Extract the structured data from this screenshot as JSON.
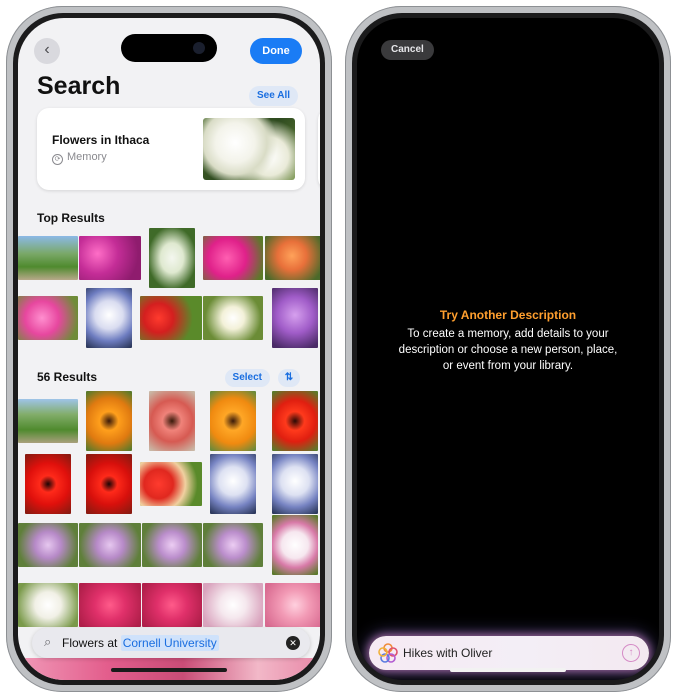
{
  "left_phone": {
    "back_icon": "chevron-left-icon",
    "done_label": "Done",
    "title": "Search",
    "see_all_label": "See All",
    "memory_card": {
      "title": "Flowers in Ithaca",
      "subtitle": "Memory",
      "icon": "memory-icon"
    },
    "top_results_label": "Top Results",
    "results_count_label": "56 Results",
    "select_label": "Select",
    "sort_icon": "sort-arrows-icon",
    "search": {
      "prefix": "Flowers at",
      "highlight": "Cornell University",
      "icon": "search-icon",
      "clear_icon": "clear-icon"
    },
    "photo_subjects": [
      "garden path",
      "pink azaleas",
      "white hyacinth",
      "pink flowers",
      "orange lilies",
      "pink blossoms",
      "purple-white iris",
      "red tulips",
      "white lilies",
      "purple bloom",
      "garden lawn",
      "orange tulip",
      "pink tulip",
      "orange tulip",
      "red tulip",
      "red tulip",
      "red tulip",
      "tulip bed",
      "white iris",
      "white iris",
      "purple bee balm",
      "purple bee balm",
      "purple bee balm",
      "purple bee balm",
      "white orchid",
      "white flowers",
      "pink flowers",
      "pink flowers",
      "white flowers",
      "pink flowers"
    ]
  },
  "right_phone": {
    "cancel_label": "Cancel",
    "message_title": "Try Another Description",
    "message_body": "To create a memory, add details to your description or choose a new person, place, or event from your library.",
    "prompt_icon": "memories-flower-icon",
    "prompt_text": "Hikes with Oliver",
    "send_icon": "arrow-up-icon"
  },
  "colors": {
    "accent_blue": "#1a7cf5",
    "message_orange": "#ff9f2e",
    "prompt_glow": "#d682c8"
  }
}
